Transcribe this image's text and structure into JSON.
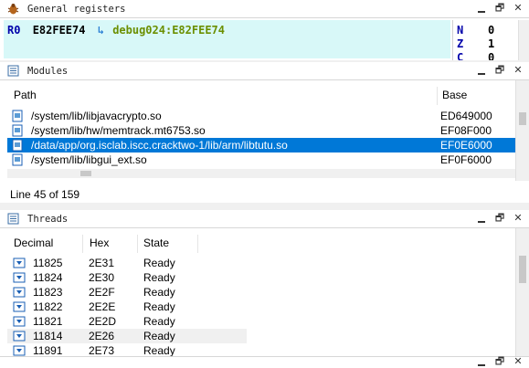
{
  "registers": {
    "title": "General registers",
    "line": {
      "name": "R0",
      "value": "E82FEE74",
      "arrow": "↳",
      "ref": "debug024:E82FEE74"
    },
    "flags": [
      {
        "name": "N",
        "value": "0"
      },
      {
        "name": "Z",
        "value": "1"
      },
      {
        "name": "C",
        "value": "0"
      }
    ]
  },
  "modules": {
    "title": "Modules",
    "columns": {
      "path": "Path",
      "base": "Base"
    },
    "rows": [
      {
        "path": "/system/lib/libjavacrypto.so",
        "base": "ED649000",
        "selected": false
      },
      {
        "path": "/system/lib/hw/memtrack.mt6753.so",
        "base": "EF08F000",
        "selected": false
      },
      {
        "path": "/data/app/org.isclab.iscc.cracktwo-1/lib/arm/libtutu.so",
        "base": "EF0E6000",
        "selected": true
      },
      {
        "path": "/system/lib/libgui_ext.so",
        "base": "EF0F6000",
        "selected": false
      }
    ],
    "status": "Line 45 of 159"
  },
  "threads": {
    "title": "Threads",
    "columns": {
      "decimal": "Decimal",
      "hex": "Hex",
      "state": "State"
    },
    "rows": [
      {
        "decimal": "11825",
        "hex": "2E31",
        "state": "Ready"
      },
      {
        "decimal": "11824",
        "hex": "2E30",
        "state": "Ready"
      },
      {
        "decimal": "11823",
        "hex": "2E2F",
        "state": "Ready"
      },
      {
        "decimal": "11822",
        "hex": "2E2E",
        "state": "Ready"
      },
      {
        "decimal": "11821",
        "hex": "2E2D",
        "state": "Ready"
      },
      {
        "decimal": "11814",
        "hex": "2E26",
        "state": "Ready"
      },
      {
        "decimal": "11891",
        "hex": "2E73",
        "state": "Ready"
      }
    ]
  },
  "colors": {
    "selection": "#0078d7",
    "register_bg": "#d8f8f8",
    "reg_name": "#0000aa",
    "reg_ref": "#6b8f00"
  },
  "window_buttons": {
    "minimize": "",
    "maximize": "🗗",
    "close": "✕"
  }
}
